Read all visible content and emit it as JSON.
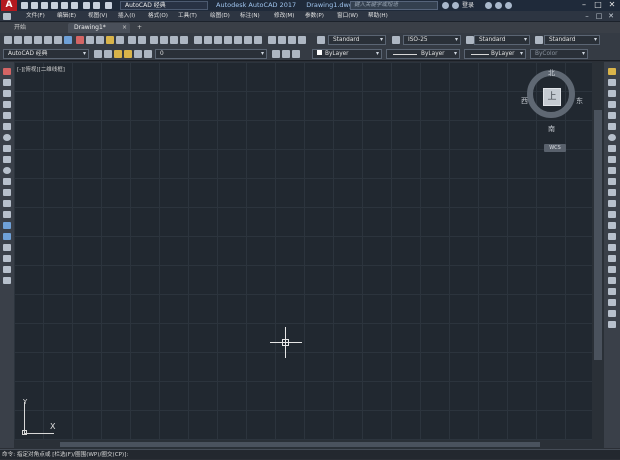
{
  "title_bar": {
    "logo_letter": "A",
    "workspace": "AutoCAD 经典",
    "app_name": "Autodesk AutoCAD 2017",
    "file_name": "Drawing1.dwg",
    "search_placeholder": "键入关键字或短语",
    "login_label": "登录",
    "minimize_glyph": "–",
    "maximize_glyph": "□",
    "close_glyph": "✕"
  },
  "menu": {
    "items": [
      "文件(F)",
      "编辑(E)",
      "视图(V)",
      "插入(I)",
      "格式(O)",
      "工具(T)",
      "绘图(D)",
      "标注(N)",
      "修改(M)",
      "参数(P)",
      "窗口(W)",
      "帮助(H)"
    ]
  },
  "tabs": {
    "start_label": "开始",
    "drawing_label": "Drawing1*",
    "close_glyph": "×",
    "add_glyph": "+"
  },
  "toolbar1": {
    "text_style": "Standard",
    "dim_style": "ISO-25",
    "table_style": "Standard",
    "mleader_style": "Standard",
    "arrow_glyph": "▾"
  },
  "toolbar2": {
    "workspace": "AutoCAD 经典",
    "layer": "0",
    "color": "ByLayer",
    "linetype": "ByLayer",
    "lineweight": "ByLayer",
    "plotstyle": "ByColor"
  },
  "canvas": {
    "viewport_label": "[-][俯视][二维线框]",
    "compass": {
      "north": "北",
      "south": "南",
      "east": "东",
      "west": "西",
      "top": "上"
    },
    "wcs_label": "WCS",
    "ucs_x": "X",
    "ucs_y": "Y"
  },
  "command_line": {
    "text": "命令:  指定对角点或 [栏选(F)/圈围(WP)/圈交(CP)]:"
  }
}
